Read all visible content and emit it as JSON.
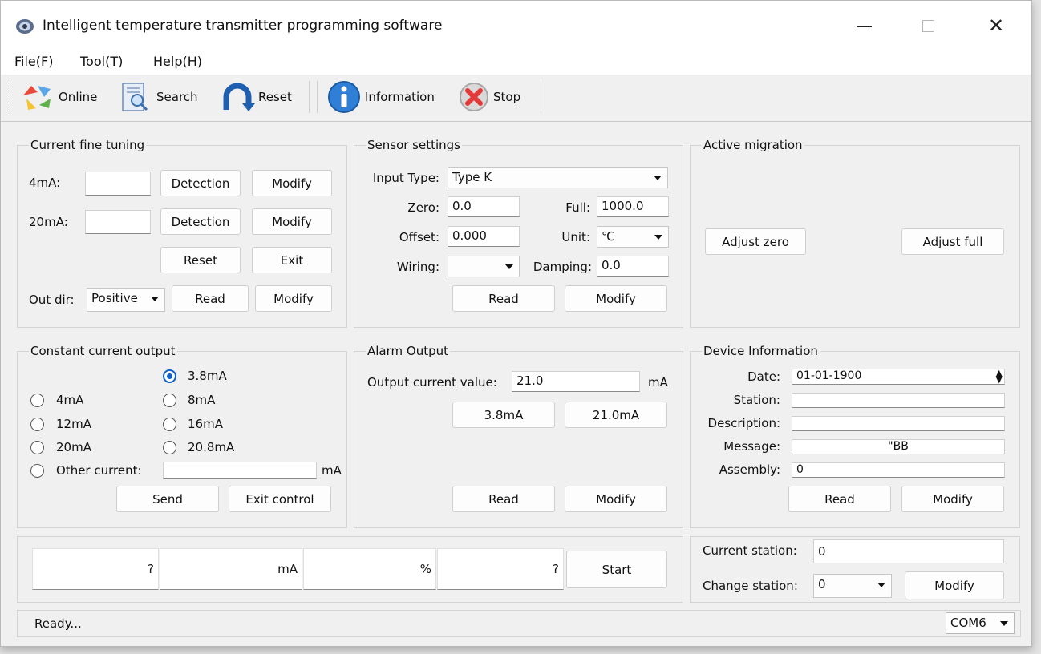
{
  "window": {
    "title": "Intelligent temperature transmitter programming software"
  },
  "menu": {
    "file": "File(F)",
    "tool": "Tool(T)",
    "help": "Help(H)"
  },
  "toolbar": {
    "online": "Online",
    "search": "Search",
    "reset": "Reset",
    "information": "Information",
    "stop": "Stop"
  },
  "fine_tuning": {
    "title": "Current fine tuning",
    "ma4_label": "4mA:",
    "ma4_value": "",
    "ma20_label": "20mA:",
    "ma20_value": "",
    "detection": "Detection",
    "modify": "Modify",
    "reset": "Reset",
    "exit": "Exit",
    "out_dir_label": "Out dir:",
    "out_dir_value": "Positive",
    "read": "Read"
  },
  "sensor": {
    "title": "Sensor settings",
    "input_type_label": "Input Type:",
    "input_type_value": "Type K",
    "zero_label": "Zero:",
    "zero_value": "0.0",
    "full_label": "Full:",
    "full_value": "1000.0",
    "offset_label": "Offset:",
    "offset_value": "0.000",
    "unit_label": "Unit:",
    "unit_value": "℃",
    "wiring_label": "Wiring:",
    "wiring_value": "",
    "damping_label": "Damping:",
    "damping_value": "0.0",
    "read": "Read",
    "modify": "Modify"
  },
  "migration": {
    "title": "Active migration",
    "adjust_zero": "Adjust zero",
    "adjust_full": "Adjust full"
  },
  "constant": {
    "title": "Constant current output",
    "options": [
      "3.8mA",
      "4mA",
      "8mA",
      "12mA",
      "16mA",
      "20mA",
      "20.8mA",
      "Other current:"
    ],
    "selected": "3.8mA",
    "other_value": "",
    "unit": "mA",
    "send": "Send",
    "exit_control": "Exit control"
  },
  "alarm": {
    "title": "Alarm Output",
    "label": "Output current value:",
    "value": "21.0",
    "unit": "mA",
    "btn_low": "3.8mA",
    "btn_high": "21.0mA",
    "read": "Read",
    "modify": "Modify"
  },
  "device": {
    "title": "Device Information",
    "date_label": "Date:",
    "date_value": "01-01-1900",
    "station_label": "Station:",
    "station_value": "",
    "description_label": "Description:",
    "description_value": "",
    "message_label": "Message:",
    "message_value": "\"BB",
    "assembly_label": "Assembly:",
    "assembly_value": "0",
    "read": "Read",
    "modify": "Modify"
  },
  "monitor": {
    "field1": "?",
    "field2": "mA",
    "field3": "%",
    "field4": "?",
    "start": "Start"
  },
  "station": {
    "current_label": "Current station:",
    "current_value": "0",
    "change_label": "Change station:",
    "change_value": "0",
    "modify": "Modify"
  },
  "status": {
    "text": "Ready...",
    "port": "COM6"
  }
}
